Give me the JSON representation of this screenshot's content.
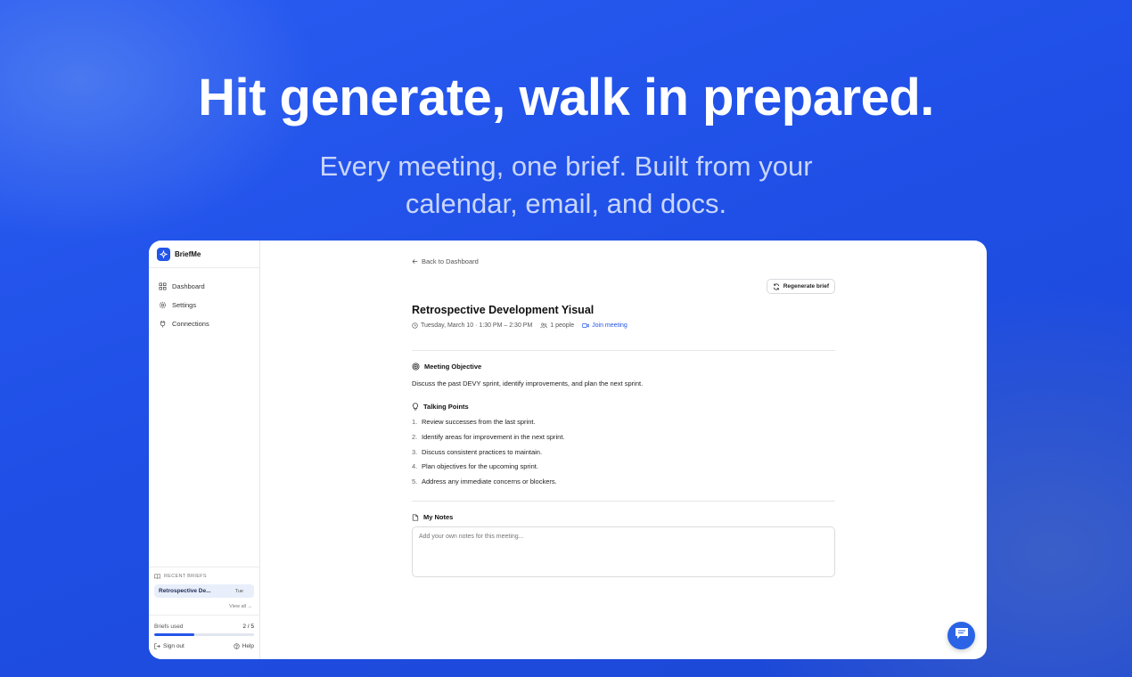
{
  "hero": {
    "title": "Hit generate, walk in prepared.",
    "subtitle": "Every meeting, one brief. Built from your calendar, email, and docs."
  },
  "sidebar": {
    "brand": "BriefMe",
    "nav": [
      {
        "label": "Dashboard",
        "icon": "grid-icon"
      },
      {
        "label": "Settings",
        "icon": "gear-icon"
      },
      {
        "label": "Connections",
        "icon": "plug-icon"
      }
    ],
    "recent": {
      "heading": "RECENT BRIEFS",
      "items": [
        {
          "title": "Retrospective De...",
          "day": "Tue"
        }
      ],
      "view_all": "View all →"
    },
    "usage": {
      "label": "Briefs used",
      "count": "2 / 5",
      "used": 2,
      "limit": 5
    },
    "sign_out": "Sign out",
    "help": "Help"
  },
  "main": {
    "back_label": "Back to Dashboard",
    "regenerate_label": "Regenerate brief",
    "meeting": {
      "title": "Retrospective Development Yisual",
      "datetime": "Tuesday, March 10 · 1:30 PM – 2:30 PM",
      "attendees": "1 people",
      "join_label": "Join meeting"
    },
    "objective": {
      "heading": "Meeting Objective",
      "text": "Discuss the past DEVY sprint, identify improvements, and plan the next sprint."
    },
    "talking_points": {
      "heading": "Talking Points",
      "items": [
        {
          "num": "1.",
          "text": "Review successes from the last sprint."
        },
        {
          "num": "2.",
          "text": "Identify areas for improvement in the next sprint."
        },
        {
          "num": "3.",
          "text": "Discuss consistent practices to maintain."
        },
        {
          "num": "4.",
          "text": "Plan objectives for the upcoming sprint."
        },
        {
          "num": "5.",
          "text": "Address any immediate concerns or blockers."
        }
      ]
    },
    "notes": {
      "heading": "My Notes",
      "placeholder": "Add your own notes for this meeting..."
    }
  },
  "colors": {
    "accent": "#2355e8",
    "background": "#1f4fe6"
  }
}
